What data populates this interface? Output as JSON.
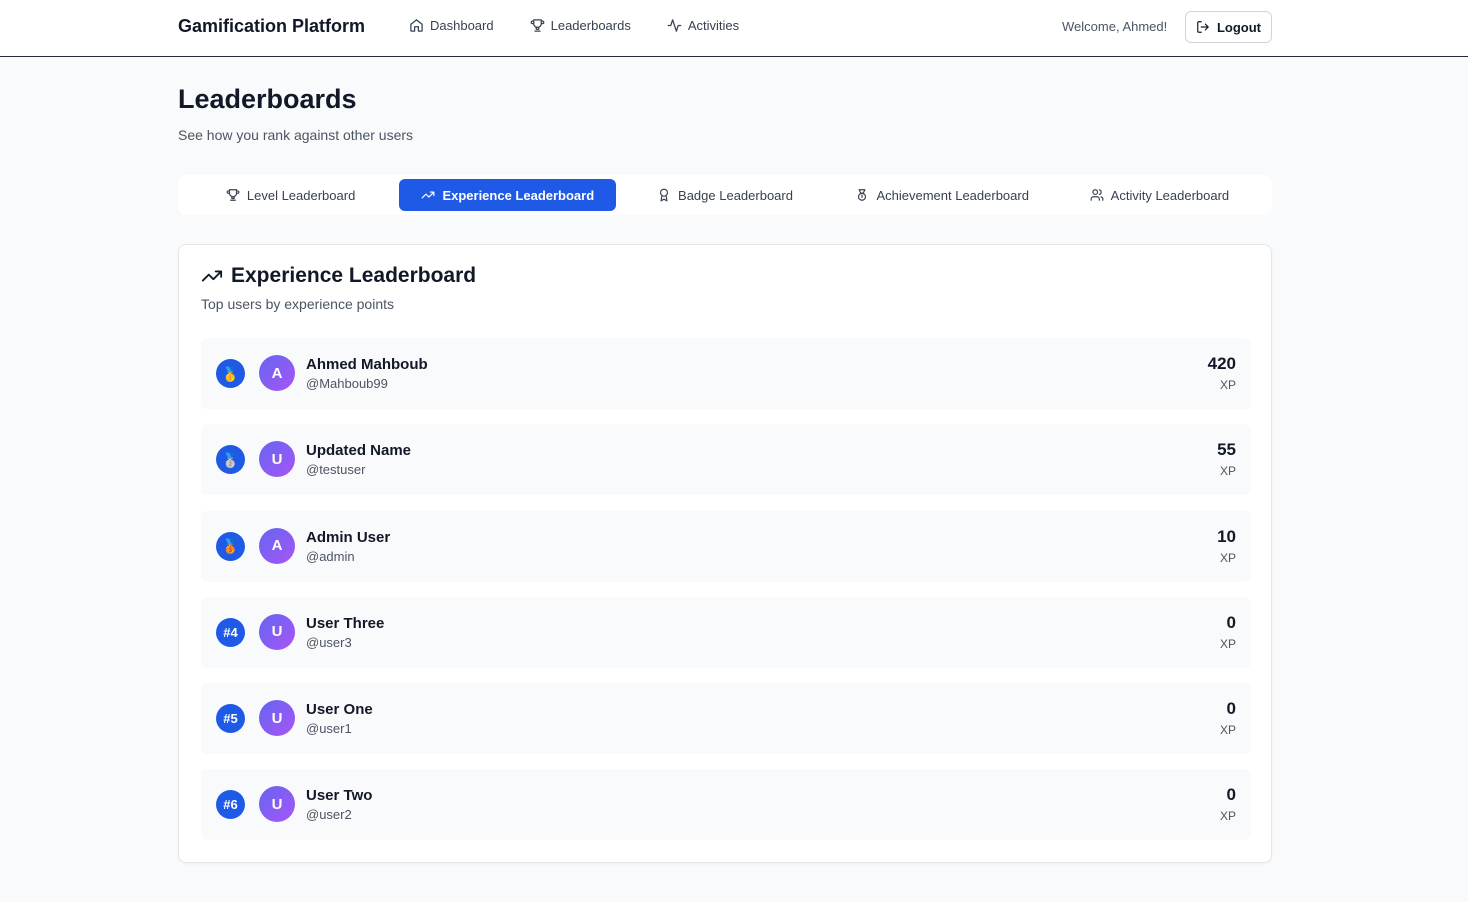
{
  "header": {
    "brand": "Gamification Platform",
    "nav": [
      {
        "label": "Dashboard",
        "icon": "home-icon"
      },
      {
        "label": "Leaderboards",
        "icon": "trophy-icon"
      },
      {
        "label": "Activities",
        "icon": "activity-icon"
      }
    ],
    "welcome": "Welcome, Ahmed!",
    "logout_label": "Logout"
  },
  "page": {
    "title": "Leaderboards",
    "subtitle": "See how you rank against other users"
  },
  "tabs": [
    {
      "label": "Level Leaderboard",
      "icon": "trophy-icon",
      "active": false
    },
    {
      "label": "Experience Leaderboard",
      "icon": "trending-up-icon",
      "active": true
    },
    {
      "label": "Badge Leaderboard",
      "icon": "award-icon",
      "active": false
    },
    {
      "label": "Achievement Leaderboard",
      "icon": "medal-icon",
      "active": false
    },
    {
      "label": "Activity Leaderboard",
      "icon": "users-icon",
      "active": false
    }
  ],
  "leaderboard": {
    "title": "Experience Leaderboard",
    "subtitle": "Top users by experience points",
    "entries": [
      {
        "rank": "🥇",
        "initial": "A",
        "name": "Ahmed Mahboub",
        "handle": "@Mahboub99",
        "score": "420",
        "unit": "XP"
      },
      {
        "rank": "🥈",
        "initial": "U",
        "name": "Updated Name",
        "handle": "@testuser",
        "score": "55",
        "unit": "XP"
      },
      {
        "rank": "🥉",
        "initial": "A",
        "name": "Admin User",
        "handle": "@admin",
        "score": "10",
        "unit": "XP"
      },
      {
        "rank": "#4",
        "initial": "U",
        "name": "User Three",
        "handle": "@user3",
        "score": "0",
        "unit": "XP"
      },
      {
        "rank": "#5",
        "initial": "U",
        "name": "User One",
        "handle": "@user1",
        "score": "0",
        "unit": "XP"
      },
      {
        "rank": "#6",
        "initial": "U",
        "name": "User Two",
        "handle": "@user2",
        "score": "0",
        "unit": "XP"
      }
    ]
  },
  "colors": {
    "accent": "#1e5ae6",
    "avatar_start": "#6366f1",
    "avatar_end": "#a855f7"
  }
}
